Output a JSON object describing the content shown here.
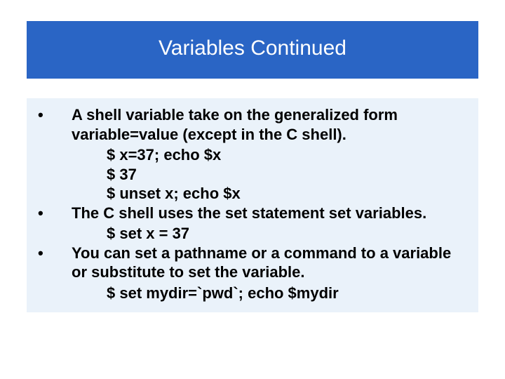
{
  "title": "Variables Continued",
  "bullets": [
    {
      "text": "A shell variable take on the generalized form variable=value (except in the C shell).",
      "subs": [
        "$ x=37; echo $x",
        "$ 37",
        "$ unset x; echo $x"
      ]
    },
    {
      "text": "The C shell uses the set statement set variables.",
      "subs": [
        "$ set x = 37"
      ]
    },
    {
      "text": "You can set a pathname or a command to a variable or substitute to set the variable.",
      "subs": [
        "$ set mydir=`pwd`; echo $mydir"
      ]
    }
  ]
}
